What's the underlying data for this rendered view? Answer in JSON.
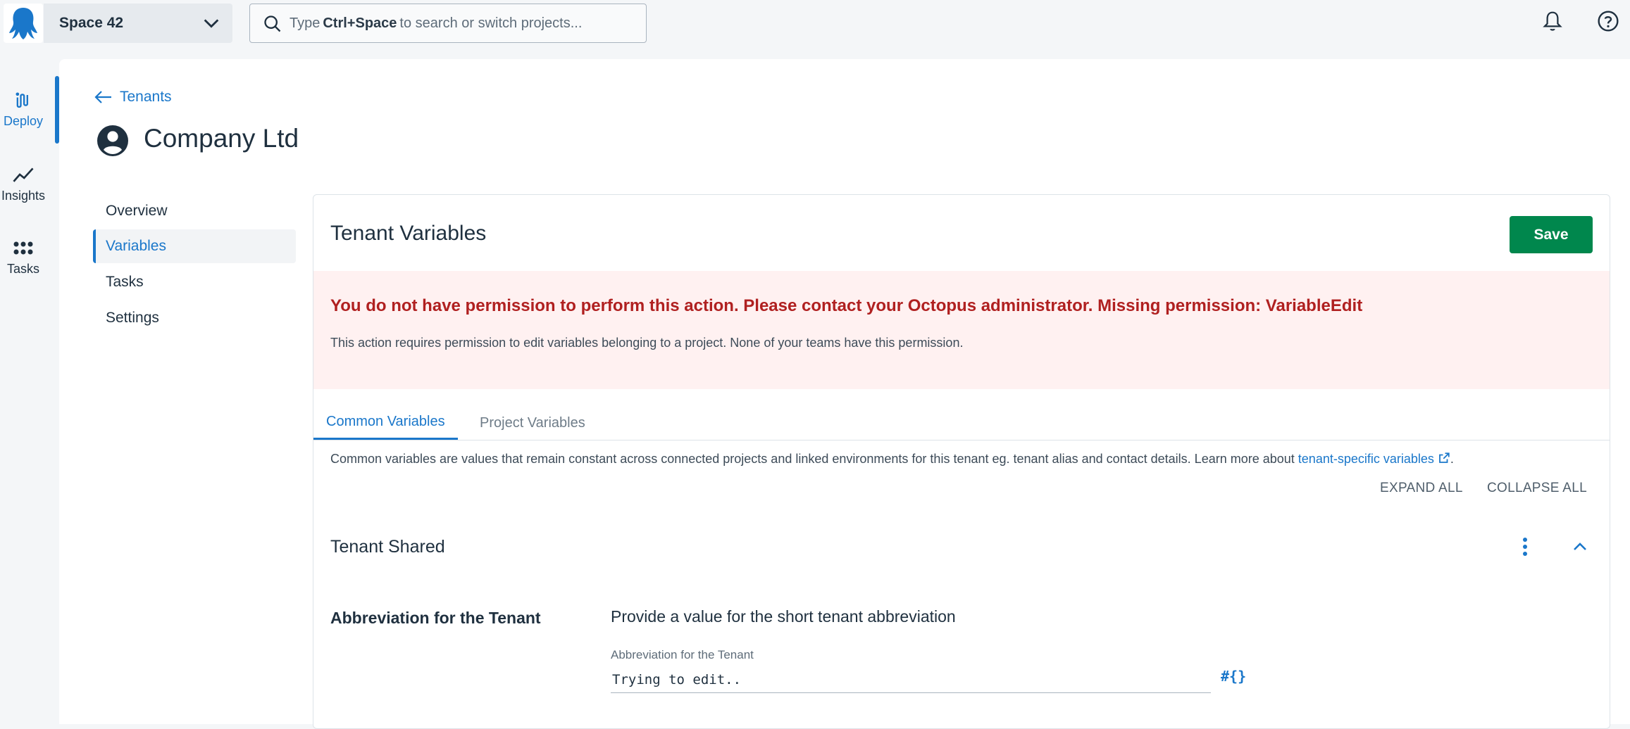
{
  "header": {
    "space_name": "Space 42",
    "search_placeholder_prefix": "Type",
    "search_shortcut": "Ctrl+Space",
    "search_placeholder_suffix": "to search or switch projects..."
  },
  "leftnav": {
    "items": [
      {
        "label": "Deploy",
        "icon": "deploy-icon"
      },
      {
        "label": "Insights",
        "icon": "insights-icon"
      },
      {
        "label": "Tasks",
        "icon": "tasks-icon"
      }
    ]
  },
  "breadcrumb": {
    "back_label": "Tenants"
  },
  "page": {
    "title": "Company Ltd"
  },
  "sidenav": {
    "items": [
      {
        "label": "Overview"
      },
      {
        "label": "Variables"
      },
      {
        "label": "Tasks"
      },
      {
        "label": "Settings"
      }
    ]
  },
  "card": {
    "title": "Tenant Variables",
    "save_label": "Save",
    "alert": {
      "title": "You do not have permission to perform this action. Please contact your Octopus administrator. Missing permission: VariableEdit",
      "body": "This action requires permission to edit variables belonging to a project. None of your teams have this permission."
    },
    "tabs": [
      {
        "label": "Common Variables"
      },
      {
        "label": "Project Variables"
      }
    ],
    "description": "Common variables are values that remain constant across connected projects and linked environments for this tenant eg. tenant alias and contact details. Learn more about",
    "description_link": "tenant-specific variables",
    "description_end": ".",
    "expand_all": "EXPAND ALL",
    "collapse_all": "COLLAPSE ALL",
    "section": {
      "title": "Tenant Shared",
      "variable": {
        "label": "Abbreviation for the Tenant",
        "help": "Provide a value for the short tenant abbreviation",
        "field_label": "Abbreviation for the Tenant",
        "value": "Trying to edit..",
        "binding_label": "#{}"
      }
    }
  },
  "colors": {
    "accent": "#1a77ca",
    "save": "#00874d",
    "error_text": "#b02020",
    "error_bg": "#fff1f1"
  }
}
